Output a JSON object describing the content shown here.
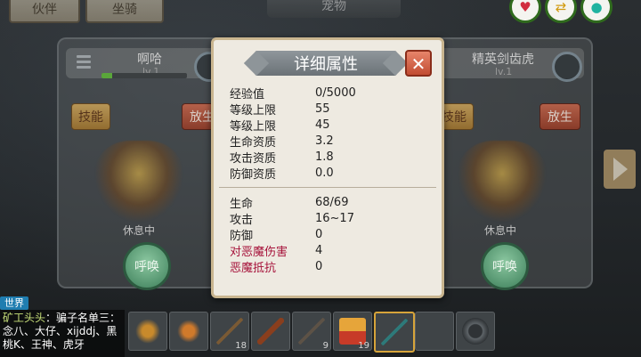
{
  "top_bar": {
    "tab_partner": "伙伴",
    "tab_mount": "坐骑",
    "tab_pet": "宠物"
  },
  "top_buttons": [
    {
      "icon": "heart-icon",
      "glyph": "♥"
    },
    {
      "icon": "swap-icon",
      "glyph": "⇄"
    },
    {
      "icon": "water-icon",
      "glyph": "●"
    }
  ],
  "left_pet": {
    "name": "啊哈",
    "level": "lv.1",
    "hp_fraction": 0.12,
    "skill_label": "技能",
    "release_label": "放生",
    "status": "休息中",
    "summon_label": "呼唤"
  },
  "right_pet": {
    "name": "精英剑齿虎",
    "level": "lv.1",
    "skill_label": "技能",
    "release_label": "放生",
    "status": "休息中",
    "summon_label": "呼唤"
  },
  "modal": {
    "title": "详细属性",
    "close_glyph": "✕",
    "stats_group1": [
      {
        "label": "经验值",
        "value": "0/5000"
      },
      {
        "label": "等级上限",
        "value": "55"
      },
      {
        "label": "等级上限",
        "value": "45"
      },
      {
        "label": "生命资质",
        "value": "3.2"
      },
      {
        "label": "攻击资质",
        "value": "1.8"
      },
      {
        "label": "防御资质",
        "value": "0.0"
      }
    ],
    "stats_group2": [
      {
        "label": "生命",
        "value": "68/69"
      },
      {
        "label": "攻击",
        "value": "16~17"
      },
      {
        "label": "防御",
        "value": "0"
      },
      {
        "label": "对恶魔伤害",
        "value": "4"
      },
      {
        "label": "恶魔抵抗",
        "value": "0"
      }
    ]
  },
  "chat": {
    "channel_tag": "世界",
    "sender": "矿工头头",
    "message": "：骗子名单三：念八、大仔、xijddj、黑桃K、王神、虎牙"
  },
  "hotbar": {
    "slots": [
      {
        "icon": "rope-icon",
        "count": ""
      },
      {
        "icon": "bird-icon",
        "count": ""
      },
      {
        "icon": "stick-icon",
        "count": "18"
      },
      {
        "icon": "torch-icon",
        "count": ""
      },
      {
        "icon": "spear-icon",
        "count": "9"
      },
      {
        "icon": "block-icon",
        "count": "19"
      },
      {
        "icon": "sword-icon",
        "count": ""
      },
      {
        "icon": "empty-slot",
        "count": ""
      },
      {
        "icon": "gear-icon",
        "count": ""
      }
    ]
  }
}
